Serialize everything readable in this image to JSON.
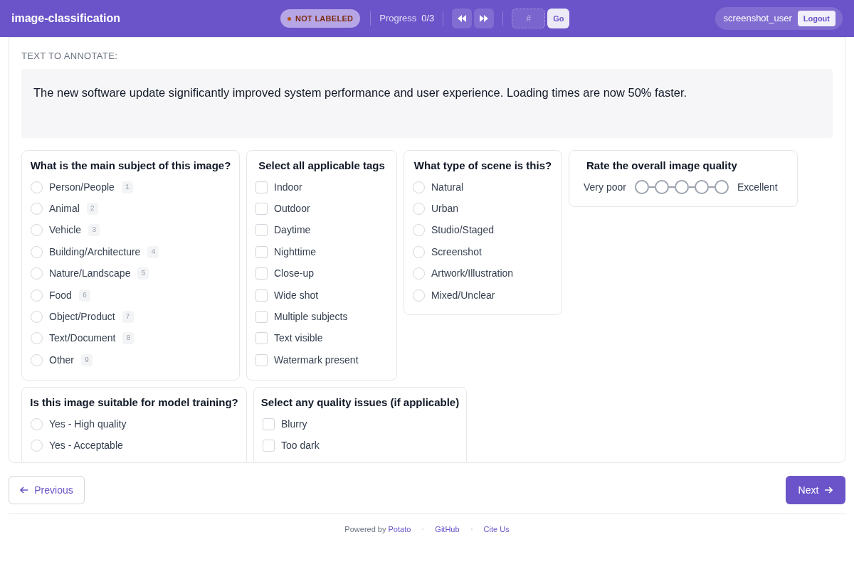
{
  "header": {
    "title": "image-classification",
    "status": "NOT LABELED",
    "progress_label": "Progress",
    "progress": "0/3",
    "jump_placeholder": "#",
    "go": "Go",
    "user": "screenshot_user",
    "logout": "Logout"
  },
  "instance": {
    "label": "TEXT TO ANNOTATE:",
    "text": "The new software update significantly improved system performance and user experience. Loading times are now 50% faster."
  },
  "questions": [
    {
      "kind": "radio",
      "title": "What is the main subject of this image?",
      "options": [
        {
          "label": "Person/People",
          "key": "1",
          "selected": false
        },
        {
          "label": "Animal",
          "key": "2",
          "selected": false
        },
        {
          "label": "Vehicle",
          "key": "3",
          "selected": false
        },
        {
          "label": "Building/Architecture",
          "key": "4",
          "selected": false
        },
        {
          "label": "Nature/Landscape",
          "key": "5",
          "selected": false
        },
        {
          "label": "Food",
          "key": "6",
          "selected": false
        },
        {
          "label": "Object/Product",
          "key": "7",
          "selected": false
        },
        {
          "label": "Text/Document",
          "key": "8",
          "selected": false
        },
        {
          "label": "Other",
          "key": "9",
          "selected": false
        }
      ]
    },
    {
      "kind": "checkbox",
      "title": "Select all applicable tags",
      "options": [
        {
          "label": "Indoor",
          "checked": false
        },
        {
          "label": "Outdoor",
          "checked": false
        },
        {
          "label": "Daytime",
          "checked": false
        },
        {
          "label": "Nighttime",
          "checked": false
        },
        {
          "label": "Close-up",
          "checked": false
        },
        {
          "label": "Wide shot",
          "checked": false
        },
        {
          "label": "Multiple subjects",
          "checked": false
        },
        {
          "label": "Text visible",
          "checked": false
        },
        {
          "label": "Watermark present",
          "checked": false
        }
      ]
    },
    {
      "kind": "radio",
      "title": "What type of scene is this?",
      "options": [
        {
          "label": "Natural",
          "selected": false
        },
        {
          "label": "Urban",
          "selected": false
        },
        {
          "label": "Studio/Staged",
          "selected": false
        },
        {
          "label": "Screenshot",
          "selected": false
        },
        {
          "label": "Artwork/Illustration",
          "selected": false
        },
        {
          "label": "Mixed/Unclear",
          "selected": false
        }
      ]
    },
    {
      "kind": "rating",
      "title": "Rate the overall image quality",
      "min_label": "Very poor",
      "max_label": "Excellent",
      "points": [
        {
          "selected": false
        },
        {
          "selected": false
        },
        {
          "selected": false
        },
        {
          "selected": false
        },
        {
          "selected": false
        }
      ]
    },
    {
      "kind": "radio",
      "title": "Is this image suitable for model training?",
      "options": [
        {
          "label": "Yes - High quality",
          "selected": false
        },
        {
          "label": "Yes - Acceptable",
          "selected": false
        }
      ]
    },
    {
      "kind": "checkbox",
      "title": "Select any quality issues (if applicable)",
      "options": [
        {
          "label": "Blurry",
          "checked": false
        },
        {
          "label": "Too dark",
          "checked": false
        }
      ]
    }
  ],
  "navigation": {
    "previous": "Previous",
    "next": "Next"
  },
  "footer": {
    "powered_by": "Powered by",
    "brand": "Potato",
    "links": [
      "GitHub",
      "Cite Us"
    ]
  }
}
